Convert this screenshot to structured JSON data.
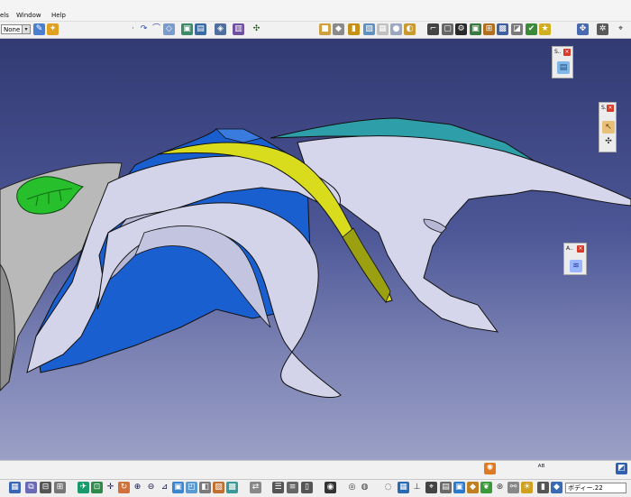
{
  "menu": {
    "items": [
      "els",
      "Window",
      "Help"
    ]
  },
  "top_toolbar": {
    "filter_combo_value": "None"
  },
  "floating_toolbars": [
    {
      "title": "S..",
      "close": "×"
    },
    {
      "title": "S..",
      "close": "×"
    },
    {
      "title": "A..",
      "close": "×"
    }
  ],
  "command_input": {
    "value": "ボディー.22"
  },
  "icons": [
    "wireframe-icon",
    "sketch-icon",
    "spline-icon",
    "surface-icon",
    "join-icon",
    "fill-icon",
    "sweep-icon",
    "shading-icon",
    "views-icon",
    "zoom-icon",
    "pan-icon",
    "rotate-icon",
    "fit-all-icon",
    "normal-view-icon",
    "hide-show-icon",
    "measure-icon",
    "snapshot-icon",
    "keyboard-icon"
  ],
  "colors": {
    "background_top": "#323a72",
    "background_bottom": "#9ba0c6",
    "part_body": "#d3d4ea",
    "part_shadow": "#b6b8d6",
    "blue_face": "#1a5fcf",
    "yellow_rib": "#d8dc1c",
    "teal_fin": "#2e9ea8",
    "green_leaf": "#27c02c",
    "gray_handle": "#b8b8b8"
  }
}
